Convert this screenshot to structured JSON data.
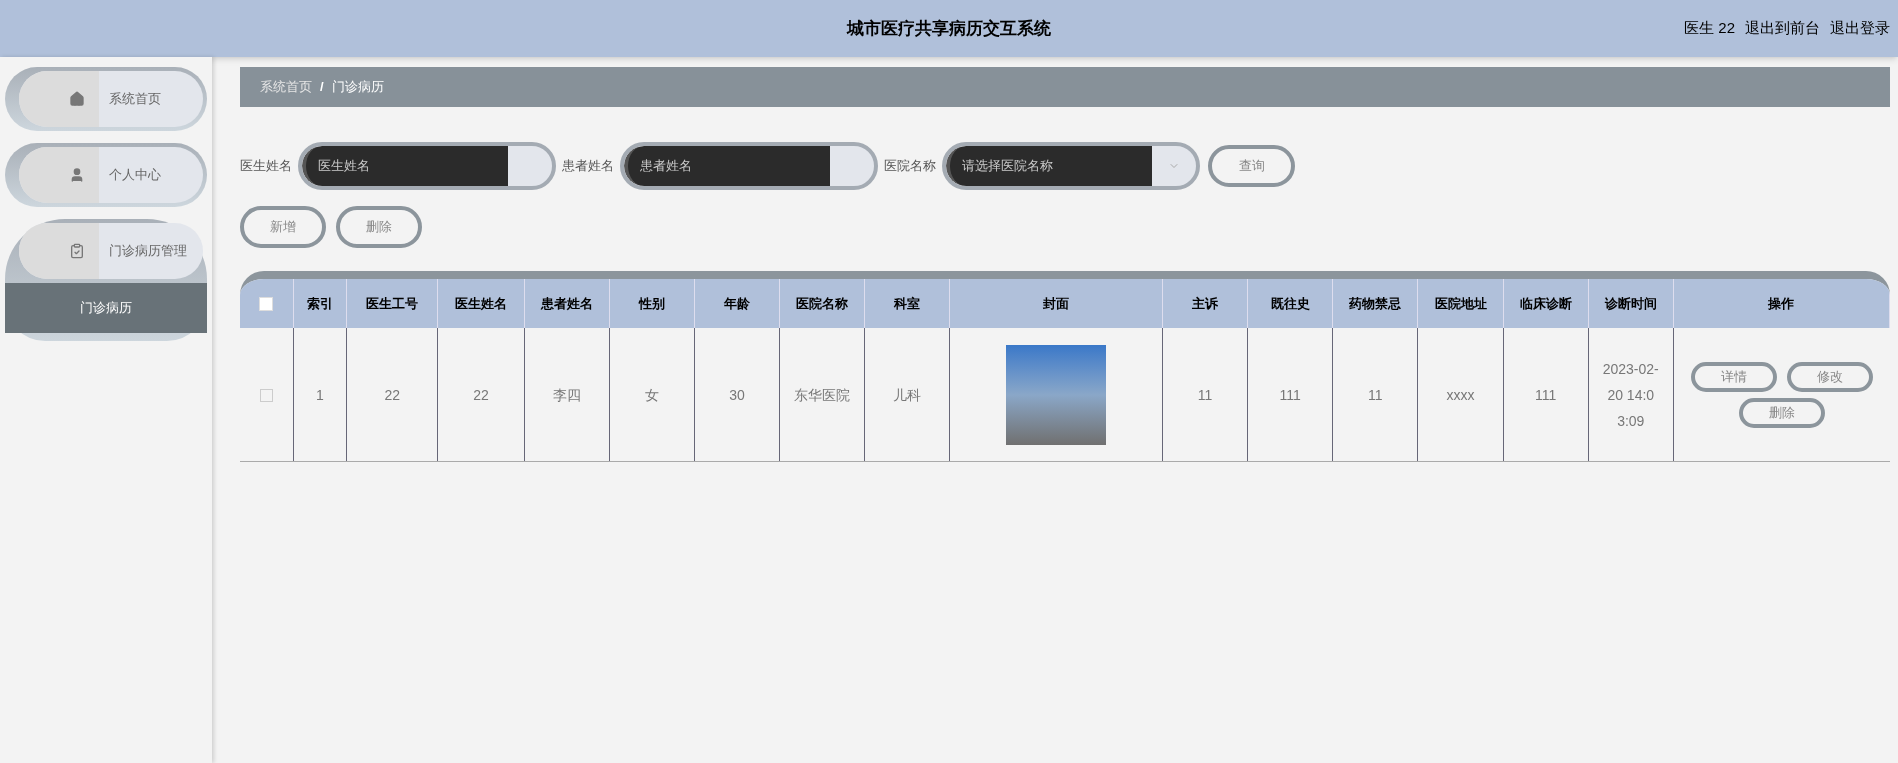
{
  "header": {
    "title": "城市医疗共享病历交互系统",
    "user": "医生 22",
    "links": [
      "退出到前台",
      "退出登录"
    ]
  },
  "sidebar": {
    "items": [
      {
        "label": "系统首页"
      },
      {
        "label": "个人中心"
      },
      {
        "label": "门诊病历管理",
        "children": [
          {
            "label": "门诊病历",
            "selected": true
          }
        ]
      }
    ]
  },
  "breadcrumb": [
    "系统首页",
    "门诊病历"
  ],
  "breadcrumb_separator": "/",
  "search": {
    "fields": [
      {
        "kind": "input",
        "label": "医生姓名",
        "placeholder": "医生姓名"
      },
      {
        "kind": "input",
        "label": "患者姓名",
        "placeholder": "患者姓名"
      },
      {
        "kind": "select",
        "label": "医院名称",
        "placeholder": "请选择医院名称"
      }
    ],
    "button": "查询"
  },
  "actions": [
    "新增",
    "删除"
  ],
  "table": {
    "select_all_checked": false,
    "columns": [
      "索引",
      "医生工号",
      "医生姓名",
      "患者姓名",
      "性别",
      "年龄",
      "医院名称",
      "科室",
      "封面",
      "主诉",
      "既往史",
      "药物禁忌",
      "医院地址",
      "临床诊断",
      "诊断时间",
      "操作"
    ],
    "rows": [
      {
        "checked": false,
        "cells": [
          "1",
          "22",
          "22",
          "李四",
          "女",
          "30",
          "东华医院",
          "儿科",
          null,
          "11",
          "111",
          "11",
          "xxxx",
          "111",
          "2023-02-20 14:03:09"
        ],
        "buttons": [
          "详情",
          "修改",
          "删除"
        ]
      }
    ]
  }
}
